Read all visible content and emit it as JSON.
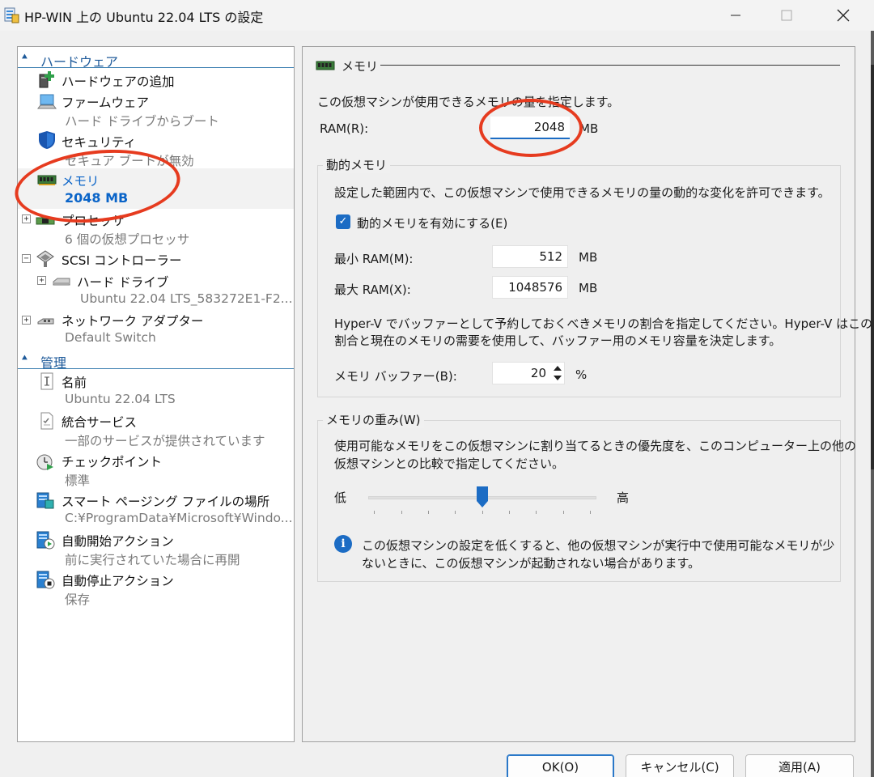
{
  "window": {
    "title": "HP-WIN 上の Ubuntu 22.04 LTS の設定"
  },
  "sidebar": {
    "hardware_header": "ハードウェア",
    "management_header": "管理",
    "items": [
      {
        "label": "ハードウェアの追加",
        "sub": "",
        "icon": "add-hardware-icon"
      },
      {
        "label": "ファームウェア",
        "sub": "ハード ドライブからブート",
        "icon": "firmware-monitor-icon"
      },
      {
        "label": "セキュリティ",
        "sub": "セキュア ブートが無効",
        "icon": "shield-icon"
      },
      {
        "label": "メモリ",
        "sub": "2048 MB",
        "icon": "memory-chip-icon"
      },
      {
        "label": "プロセッサ",
        "sub": "6 個の仮想プロセッサ",
        "icon": "processor-icon"
      },
      {
        "label": "SCSI コントローラー",
        "sub": "",
        "icon": "scsi-controller-icon"
      },
      {
        "label": "ハード ドライブ",
        "sub": "Ubuntu 22.04 LTS_583272E1-F2...",
        "icon": "hard-drive-icon"
      },
      {
        "label": "ネットワーク アダプター",
        "sub": "Default Switch",
        "icon": "network-adapter-icon"
      },
      {
        "label": "名前",
        "sub": "Ubuntu 22.04 LTS",
        "icon": "name-document-icon"
      },
      {
        "label": "統合サービス",
        "sub": "一部のサービスが提供されています",
        "icon": "integration-services-icon"
      },
      {
        "label": "チェックポイント",
        "sub": "標準",
        "icon": "checkpoint-icon"
      },
      {
        "label": "スマート ページング ファイルの場所",
        "sub": "C:¥ProgramData¥Microsoft¥Windo...",
        "icon": "smart-paging-icon"
      },
      {
        "label": "自動開始アクション",
        "sub": "前に実行されていた場合に再開",
        "icon": "auto-start-icon"
      },
      {
        "label": "自動停止アクション",
        "sub": "保存",
        "icon": "auto-stop-icon"
      }
    ]
  },
  "memory": {
    "section_title": "メモリ",
    "description": "この仮想マシンが使用できるメモリの量を指定します。",
    "ram_label": "RAM(R):",
    "ram_value": "2048",
    "ram_unit": "MB",
    "dynamic": {
      "title": "動的メモリ",
      "description": "設定した範囲内で、この仮想マシンで使用できるメモリの量の動的な変化を許可できます。",
      "enable_label": "動的メモリを有効にする(E)",
      "enabled": true,
      "min_label": "最小 RAM(M):",
      "min_value": "512",
      "min_unit": "MB",
      "max_label": "最大 RAM(X):",
      "max_value": "1048576",
      "max_unit": "MB",
      "buffer_desc_1": "Hyper-V でバッファーとして予約しておくべきメモリの割合を指定してください。Hyper-V はこの",
      "buffer_desc_2": "割合と現在のメモリの需要を使用して、バッファー用のメモリ容量を決定します。",
      "buffer_label": "メモリ バッファー(B):",
      "buffer_value": "20",
      "buffer_unit": "%"
    },
    "weight": {
      "title": "メモリの重み(W)",
      "desc_1": "使用可能なメモリをこの仮想マシンに割り当てるときの優先度を、このコンピューター上の他の",
      "desc_2": "仮想マシンとの比較で指定してください。",
      "low_label": "低",
      "high_label": "高",
      "slider_value_fraction": 0.5,
      "info_1": "この仮想マシンの設定を低くすると、他の仮想マシンが実行中で使用可能なメモリが少",
      "info_2": "ないときに、この仮想マシンが起動されない場合があります。"
    }
  },
  "buttons": {
    "ok": "OK(O)",
    "cancel": "キャンセル(C)",
    "apply": "適用(A)"
  },
  "colors": {
    "accent": "#1c6cc4",
    "annotation": "#e63b1f"
  }
}
